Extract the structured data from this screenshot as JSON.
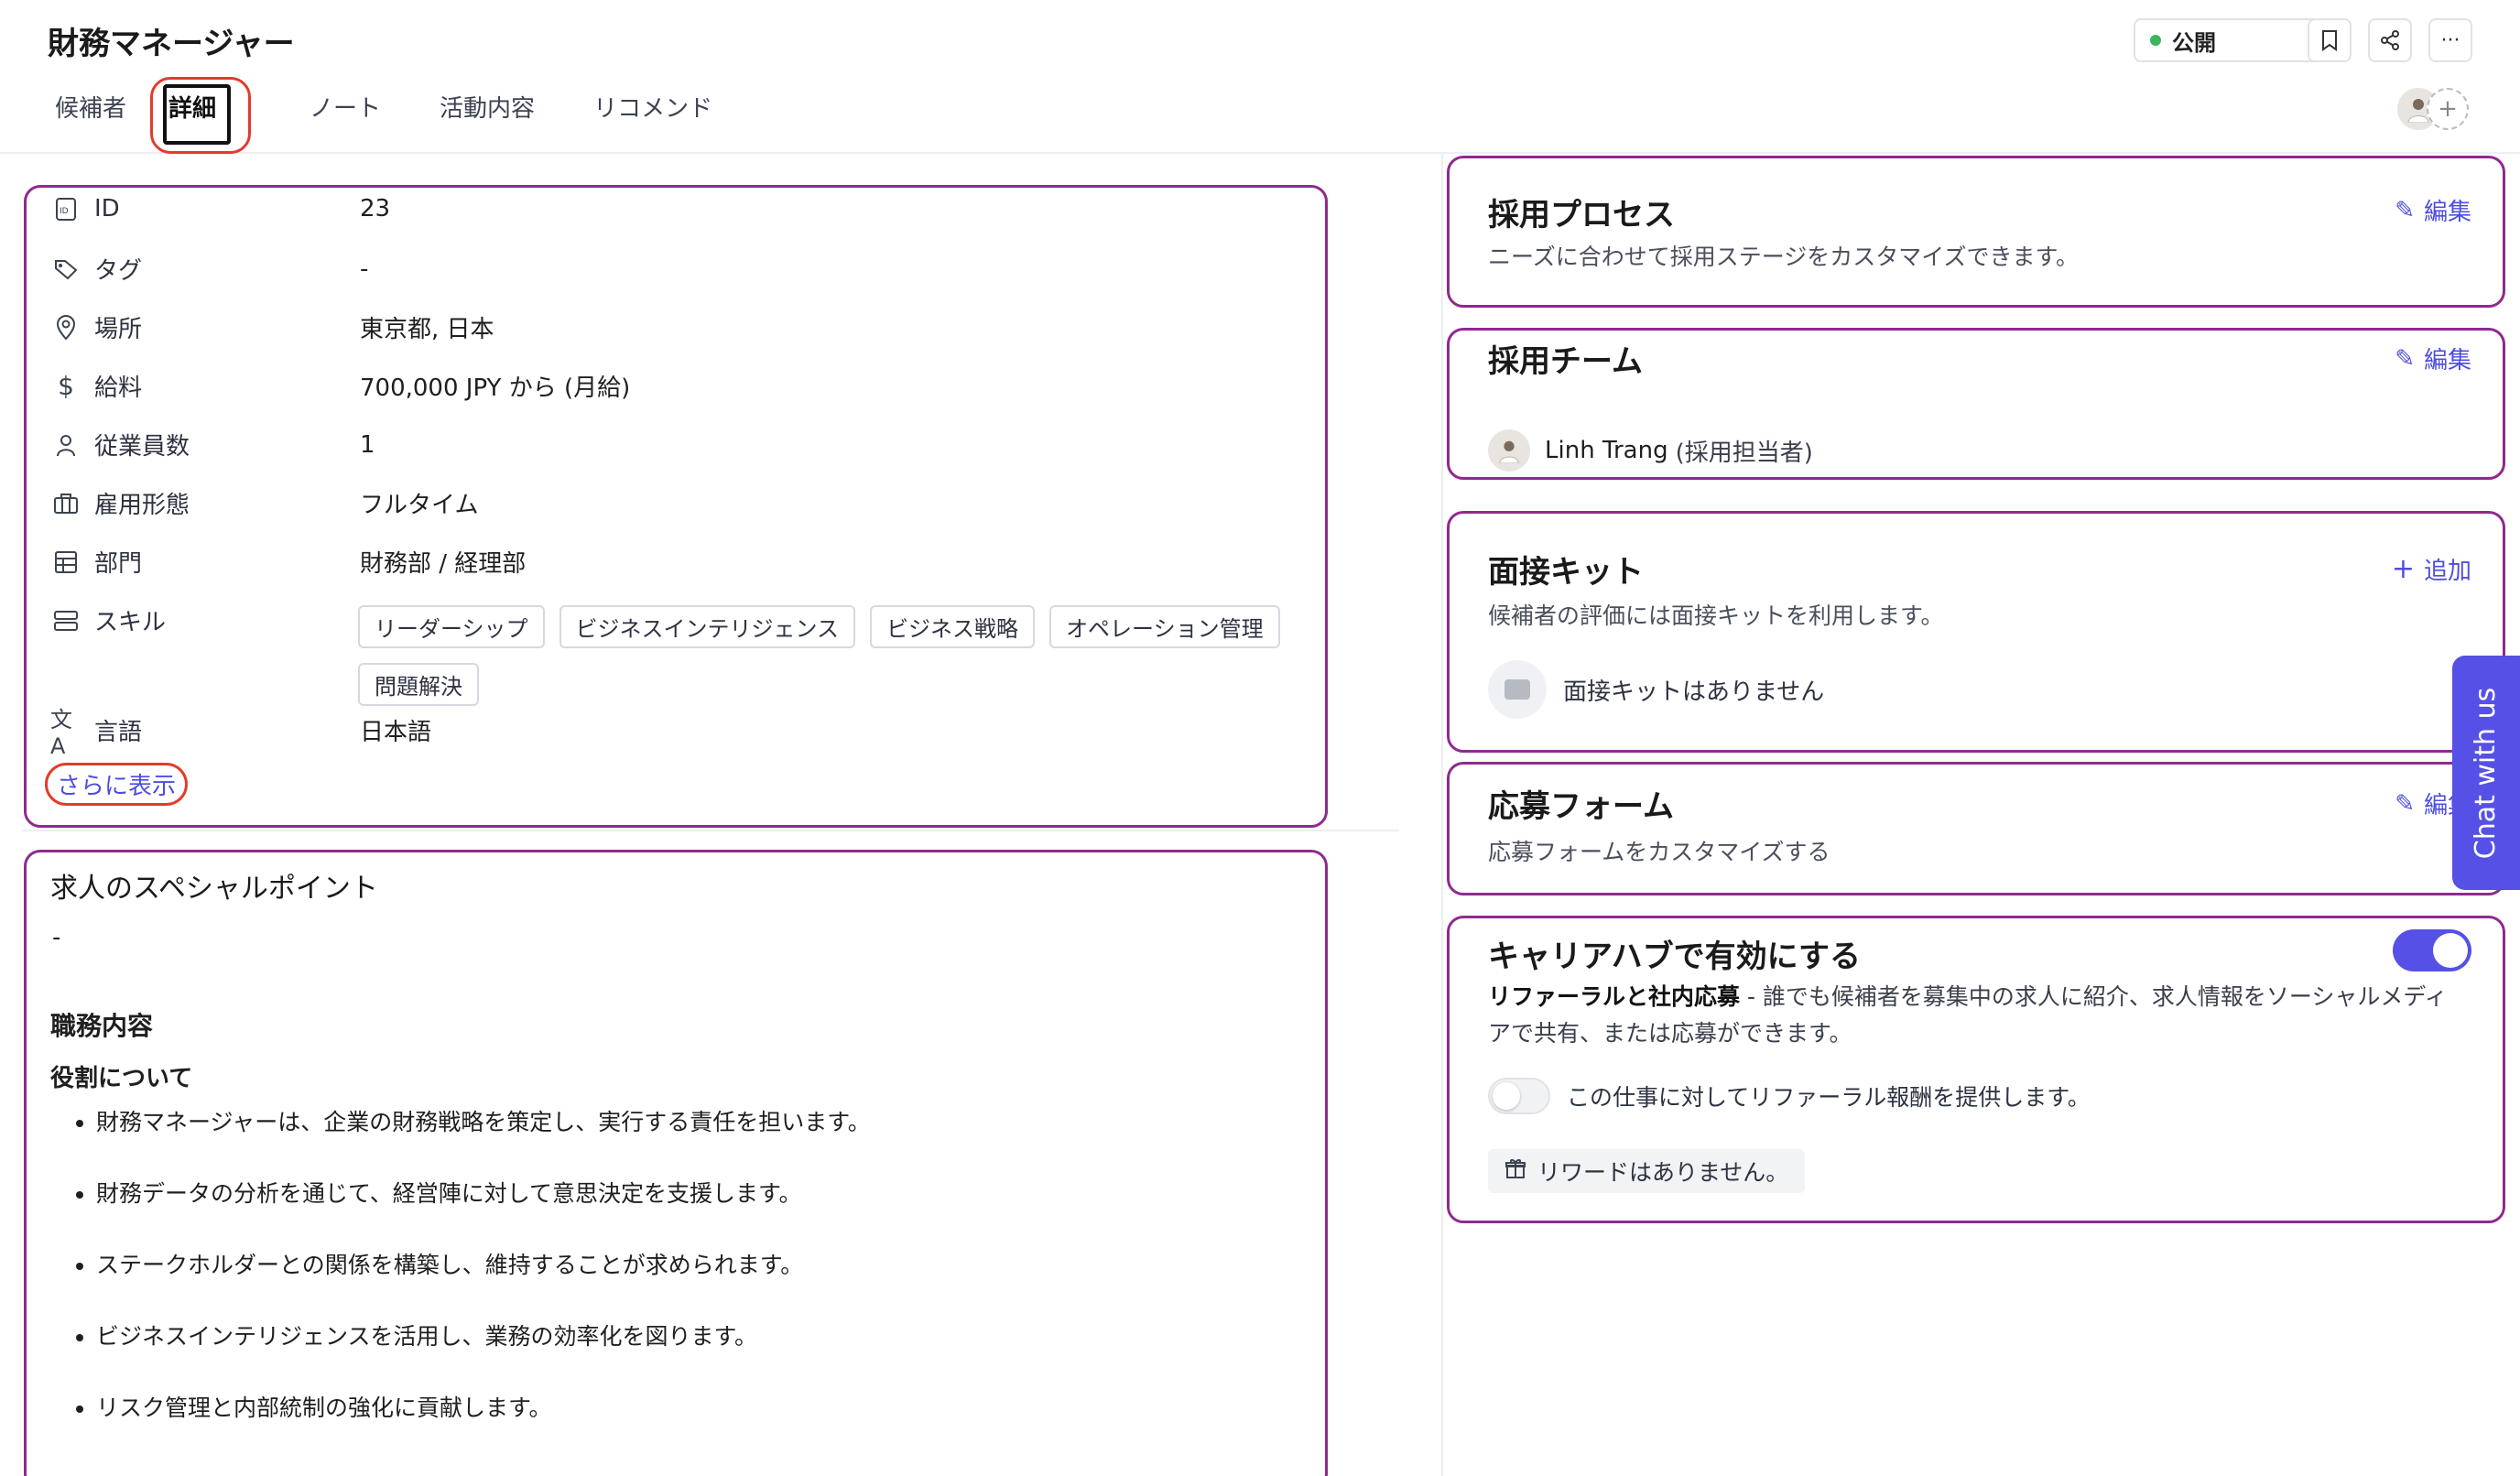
{
  "header": {
    "title": "財務マネージャー",
    "tabs": [
      "候補者",
      "詳細",
      "ノート",
      "活動内容",
      "リコメンド"
    ],
    "active_tab": "詳細",
    "status": {
      "label": "公開",
      "color": "#3bb55e"
    },
    "add_member_symbol": "+"
  },
  "details": {
    "rows": [
      {
        "icon": "id-icon",
        "label": "ID",
        "value": "23"
      },
      {
        "icon": "tag-icon",
        "label": "タグ",
        "value": "-"
      },
      {
        "icon": "location-pin-icon",
        "label": "場所",
        "value": "東京都, 日本"
      },
      {
        "icon": "dollar-icon",
        "label": "給料",
        "value": "700,000 JPY から (月給)"
      },
      {
        "icon": "person-icon",
        "label": "従業員数",
        "value": "1"
      },
      {
        "icon": "briefcase-icon",
        "label": "雇用形態",
        "value": "フルタイム"
      },
      {
        "icon": "table-icon",
        "label": "部門",
        "value": "財務部 / 経理部"
      },
      {
        "icon": "stack-icon",
        "label": "スキル",
        "value": ""
      },
      {
        "icon": "translate-icon",
        "label": "言語",
        "value": "日本語"
      }
    ],
    "skills": [
      "リーダーシップ",
      "ビジネスインテリジェンス",
      "ビジネス戦略",
      "オペレーション管理",
      "問題解決"
    ],
    "show_more": "さらに表示"
  },
  "special": {
    "title": "求人のスペシャルポイント",
    "value": "-",
    "duties_title": "職務内容",
    "role_title": "役割について",
    "bullets": [
      "財務マネージャーは、企業の財務戦略を策定し、実行する責任を担います。",
      "財務データの分析を通じて、経営陣に対して意思決定を支援します。",
      "ステークホルダーとの関係を構築し、維持することが求められます。",
      "ビジネスインテリジェンスを活用し、業務の効率化を図ります。",
      "リスク管理と内部統制の強化に貢献します。"
    ]
  },
  "process": {
    "title": "採用プロセス",
    "subtitle": "ニーズに合わせて採用ステージをカスタマイズできます。",
    "edit": "編集"
  },
  "team": {
    "title": "採用チーム",
    "edit": "編集",
    "member_name": "Linh Trang",
    "member_role": "(採用担当者)"
  },
  "kit": {
    "title": "面接キット",
    "subtitle": "候補者の評価には面接キットを利用します。",
    "add": "追加",
    "empty": "面接キットはありません"
  },
  "form": {
    "title": "応募フォーム",
    "subtitle": "応募フォームをカスタマイズする",
    "edit": "編集"
  },
  "hub": {
    "title": "キャリアハブで有効にする",
    "enabled": true,
    "desc_bold": "リファーラルと社内応募",
    "desc_rest": " - 誰でも候補者を募集中の求人に紹介、求人情報をソーシャルメディアで共有、または応募ができます。",
    "referral_label": "この仕事に対してリファーラル報酬を提供します。",
    "referral_enabled": false,
    "reward": "リワードはありません。"
  },
  "chat": {
    "label": "Chat with us"
  },
  "colors": {
    "accent": "#5650e6",
    "highlight_border": "#8e2a8e",
    "annotation": "#e23b2e"
  }
}
